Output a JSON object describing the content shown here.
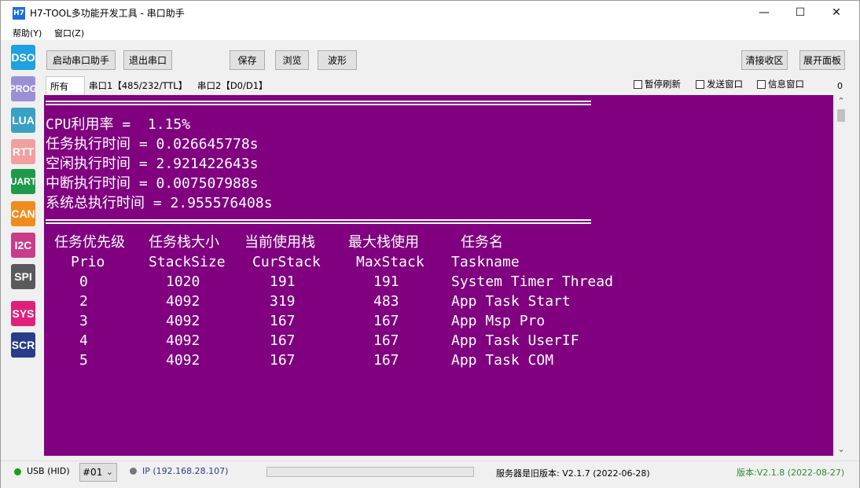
{
  "window": {
    "title": "H7-TOOL多功能开发工具 - 串口助手",
    "icon_text": "H7",
    "minimize_glyph": "—",
    "maximize_glyph": "☐",
    "close_glyph": "✕"
  },
  "menu": {
    "items": [
      {
        "label": "帮助(Y)"
      },
      {
        "label": "窗口(Z)"
      }
    ]
  },
  "sidebar": {
    "items": [
      {
        "label": "DSO",
        "color": "#1fa0e0"
      },
      {
        "label": "PROG",
        "color": "#9b8fd6"
      },
      {
        "label": "LUA",
        "color": "#3aa0c4"
      },
      {
        "label": "RTT",
        "color": "#f0a0a0"
      },
      {
        "label": "UART",
        "color": "#1f9a4a"
      },
      {
        "label": "CAN",
        "color": "#f08c1e"
      },
      {
        "label": "I2C",
        "color": "#c83c8c"
      },
      {
        "label": "SPI",
        "color": "#5a5a5a"
      },
      {
        "label": "SYS",
        "color": "#e0207a"
      },
      {
        "label": "SCR",
        "color": "#283c8c"
      }
    ]
  },
  "toolbar": {
    "start_label": "启动串口助手",
    "exit_label": "退出串口",
    "save_label": "保存",
    "browse_label": "浏览",
    "wave_label": "波形",
    "clear_label": "清接收区",
    "expand_label": "展开面板"
  },
  "tabs": {
    "all": "所有",
    "serial1": "串口1【485/232/TTL】",
    "serial2": "串口2【D0/D1】"
  },
  "options": {
    "pause_refresh": "暂停刷新",
    "send_window": "发送窗口",
    "info_window": "信息窗口",
    "counter": "0"
  },
  "terminal": {
    "background": "#800080",
    "separator": "================================================================",
    "cpu_usage": "CPU利用率 =  1.15%",
    "task_exec_time": "任务执行时间 = 0.026645778s",
    "idle_exec_time": "空闲执行时间 = 2.921422643s",
    "isr_exec_time": "中断执行时间 = 0.007507988s",
    "total_exec_time": "系统总执行时间 = 2.955576408s",
    "headers_cn": [
      "任务优先级",
      "任务栈大小",
      "当前使用栈",
      "最大栈使用",
      "任务名"
    ],
    "headers_en": [
      "Prio",
      "StackSize",
      "CurStack",
      "MaxStack",
      "Taskname"
    ],
    "rows": [
      [
        "0",
        "1020",
        "191",
        "191",
        "System Timer Thread"
      ],
      [
        "2",
        "4092",
        "319",
        "483",
        "App Task Start"
      ],
      [
        "3",
        "4092",
        "167",
        "167",
        "App Msp Pro"
      ],
      [
        "4",
        "4092",
        "167",
        "167",
        "App Task UserIF"
      ],
      [
        "5",
        "4092",
        "167",
        "167",
        "App Task COM"
      ]
    ]
  },
  "status": {
    "usb_label": "USB (HID)",
    "usb_color": "#1a9e1a",
    "device_select": "#01",
    "ip_label": "IP (192.168.28.107)",
    "ip_color": "#777777",
    "server_version": "服务器是旧版本: V2.1.7 (2022-06-28)",
    "app_version": "版本:V2.1.8 (2022-08-27)",
    "app_version_color": "#2e8b2e"
  }
}
